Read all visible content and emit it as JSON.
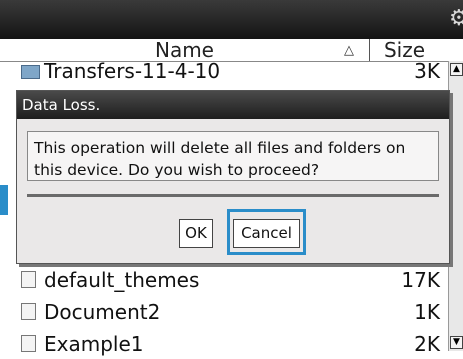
{
  "header": {
    "name_label": "Name",
    "size_label": "Size",
    "sort_icon": "triangle-up-icon"
  },
  "files": [
    {
      "name": "Transfers-11-4-10",
      "size": "3K",
      "icon": "transfer-folder-icon"
    },
    {
      "name": "default_themes",
      "size": "17K",
      "icon": "document-icon"
    },
    {
      "name": "Document2",
      "size": "1K",
      "icon": "document-icon"
    },
    {
      "name": "Example1",
      "size": "2K",
      "icon": "document-icon"
    }
  ],
  "dialog": {
    "title": "Data Loss.",
    "message_line1": "This operation will delete all files and folders on",
    "message_line2": "this device. Do you wish to proceed?",
    "ok_label": "OK",
    "cancel_label": "Cancel"
  },
  "colors": {
    "accent": "#2a8dc9",
    "titlebar": "#1e1e1e"
  }
}
